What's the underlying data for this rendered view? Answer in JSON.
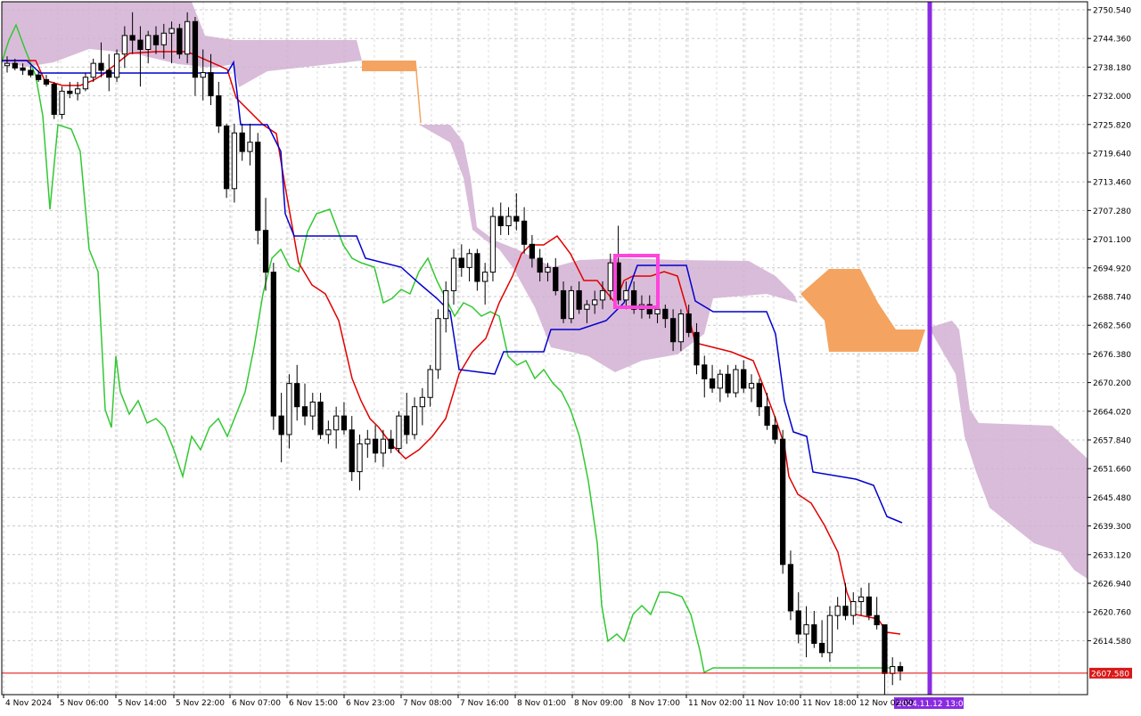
{
  "chart_data": {
    "type": "candlestick",
    "y_ticks": [
      "2750.540",
      "2744.360",
      "2738.180",
      "2732.000",
      "2725.820",
      "2719.640",
      "2713.460",
      "2707.280",
      "2701.100",
      "2694.920",
      "2688.740",
      "2682.560",
      "2676.380",
      "2670.200",
      "2664.020",
      "2657.840",
      "2651.660",
      "2645.480",
      "2639.300",
      "2633.120",
      "2626.940",
      "2620.760",
      "2614.580"
    ],
    "ylim": [
      2603.5,
      2752.5
    ],
    "x_labels": [
      "4 Nov 2024",
      "5 Nov 06:00",
      "5 Nov 14:00",
      "5 Nov 22:00",
      "6 Nov 07:00",
      "6 Nov 15:00",
      "6 Nov 23:00",
      "7 Nov 08:00",
      "7 Nov 16:00",
      "8 Nov 01:00",
      "8 Nov 09:00",
      "8 Nov 17:00",
      "11 Nov 02:00",
      "11 Nov 10:00",
      "11 Nov 18:00",
      "12 Nov 02:00"
    ],
    "current_price": "2607.580",
    "vline_label": "2024.11.12 13:00",
    "candles": [
      [
        2738.5,
        2740.5,
        2737.0,
        2739.0
      ],
      [
        2739.0,
        2740.0,
        2737.5,
        2738.0
      ],
      [
        2738.0,
        2739.0,
        2736.5,
        2737.5
      ],
      [
        2737.5,
        2738.5,
        2736.0,
        2736.5
      ],
      [
        2736.5,
        2737.5,
        2735.0,
        2735.5
      ],
      [
        2735.5,
        2736.5,
        2734.0,
        2734.5
      ],
      [
        2734.5,
        2735.0,
        2727.0,
        2728.0
      ],
      [
        2728.0,
        2734.0,
        2727.0,
        2733.0
      ],
      [
        2733.0,
        2735.0,
        2731.5,
        2732.5
      ],
      [
        2732.5,
        2735.0,
        2731.0,
        2733.5
      ],
      [
        2733.5,
        2737.0,
        2733.0,
        2736.0
      ],
      [
        2736.0,
        2740.0,
        2735.0,
        2739.0
      ],
      [
        2739.0,
        2743.5,
        2736.0,
        2737.5
      ],
      [
        2737.5,
        2741.0,
        2733.0,
        2736.0
      ],
      [
        2736.0,
        2742.0,
        2735.0,
        2741.0
      ],
      [
        2741.0,
        2747.0,
        2738.0,
        2745.0
      ],
      [
        2745.0,
        2750.0,
        2741.0,
        2744.0
      ],
      [
        2744.0,
        2747.0,
        2734.0,
        2742.0
      ],
      [
        2742.0,
        2746.0,
        2739.0,
        2745.0
      ],
      [
        2745.0,
        2747.0,
        2741.0,
        2743.0
      ],
      [
        2743.0,
        2747.5,
        2740.0,
        2745.5
      ],
      [
        2745.5,
        2748.0,
        2739.0,
        2746.5
      ],
      [
        2746.5,
        2747.5,
        2740.0,
        2741.0
      ],
      [
        2741.0,
        2750.0,
        2739.0,
        2748.0
      ],
      [
        2748.0,
        2749.0,
        2732.0,
        2736.0
      ],
      [
        2736.0,
        2742.0,
        2731.0,
        2737.0
      ],
      [
        2737.0,
        2741.0,
        2730.0,
        2732.0
      ],
      [
        2732.0,
        2735.0,
        2724.0,
        2725.5
      ],
      [
        2725.5,
        2726.0,
        2710.0,
        2712.0
      ],
      [
        2712.0,
        2726.0,
        2709.0,
        2724.0
      ],
      [
        2724.0,
        2726.0,
        2718.0,
        2720.0
      ],
      [
        2720.0,
        2726.0,
        2717.0,
        2722.0
      ],
      [
        2722.0,
        2724.0,
        2700.0,
        2703.0
      ],
      [
        2703.0,
        2710.0,
        2690.0,
        2694.0
      ],
      [
        2694.0,
        2696.0,
        2660.0,
        2663.0
      ],
      [
        2663.0,
        2668.0,
        2653.0,
        2659.0
      ],
      [
        2659.0,
        2672.0,
        2656.0,
        2670.0
      ],
      [
        2670.0,
        2674.0,
        2662.0,
        2665.0
      ],
      [
        2665.0,
        2670.0,
        2661.0,
        2663.0
      ],
      [
        2663.0,
        2668.0,
        2660.0,
        2666.0
      ],
      [
        2666.0,
        2668.0,
        2658.0,
        2659.0
      ],
      [
        2659.0,
        2662.0,
        2657.0,
        2660.0
      ],
      [
        2660.0,
        2665.0,
        2656.0,
        2663.0
      ],
      [
        2663.0,
        2666.0,
        2659.0,
        2660.0
      ],
      [
        2660.0,
        2663.0,
        2649.0,
        2651.0
      ],
      [
        2651.0,
        2659.0,
        2647.0,
        2657.0
      ],
      [
        2657.0,
        2660.0,
        2654.0,
        2658.0
      ],
      [
        2658.0,
        2661.0,
        2653.0,
        2655.0
      ],
      [
        2655.0,
        2660.0,
        2652.0,
        2658.0
      ],
      [
        2658.0,
        2660.0,
        2655.0,
        2656.0
      ],
      [
        2656.0,
        2664.0,
        2655.0,
        2663.0
      ],
      [
        2663.0,
        2668.0,
        2657.0,
        2659.0
      ],
      [
        2659.0,
        2667.0,
        2658.0,
        2665.0
      ],
      [
        2665.0,
        2669.0,
        2661.0,
        2667.0
      ],
      [
        2667.0,
        2674.0,
        2665.0,
        2673.0
      ],
      [
        2673.0,
        2686.0,
        2671.0,
        2684.0
      ],
      [
        2684.0,
        2692.0,
        2681.0,
        2690.0
      ],
      [
        2690.0,
        2699.0,
        2687.0,
        2697.0
      ],
      [
        2697.0,
        2700.0,
        2693.0,
        2695.0
      ],
      [
        2695.0,
        2699.0,
        2692.0,
        2698.0
      ],
      [
        2698.0,
        2699.0,
        2690.0,
        2692.0
      ],
      [
        2692.0,
        2696.0,
        2687.0,
        2694.0
      ],
      [
        2694.0,
        2708.0,
        2692.0,
        2706.0
      ],
      [
        2706.0,
        2709.0,
        2702.0,
        2704.0
      ],
      [
        2704.0,
        2708.0,
        2702.0,
        2706.0
      ],
      [
        2706.0,
        2711.0,
        2703.0,
        2705.0
      ],
      [
        2705.0,
        2708.0,
        2698.0,
        2700.0
      ],
      [
        2700.0,
        2702.0,
        2695.0,
        2697.0
      ],
      [
        2697.0,
        2699.0,
        2692.0,
        2694.0
      ],
      [
        2694.0,
        2696.0,
        2692.0,
        2695.0
      ],
      [
        2695.0,
        2697.0,
        2689.0,
        2690.0
      ],
      [
        2690.0,
        2692.0,
        2683.0,
        2684.0
      ],
      [
        2684.0,
        2691.0,
        2683.0,
        2690.0
      ],
      [
        2690.0,
        2692.0,
        2685.0,
        2686.0
      ],
      [
        2686.0,
        2688.0,
        2683.0,
        2687.0
      ],
      [
        2687.0,
        2690.0,
        2685.0,
        2688.0
      ],
      [
        2688.0,
        2692.0,
        2686.0,
        2690.0
      ],
      [
        2690.0,
        2698.0,
        2688.0,
        2696.0
      ],
      [
        2696.0,
        2704.0,
        2687.0,
        2688.0
      ],
      [
        2688.0,
        2692.0,
        2686.0,
        2690.0
      ],
      [
        2690.0,
        2692.0,
        2685.0,
        2686.0
      ],
      [
        2686.0,
        2689.0,
        2684.0,
        2687.0
      ],
      [
        2687.0,
        2689.0,
        2684.0,
        2685.0
      ],
      [
        2685.0,
        2688.0,
        2683.0,
        2686.0
      ],
      [
        2686.0,
        2687.0,
        2682.0,
        2684.0
      ],
      [
        2684.0,
        2686.0,
        2677.0,
        2679.0
      ],
      [
        2679.0,
        2686.0,
        2677.0,
        2685.0
      ],
      [
        2685.0,
        2687.0,
        2680.0,
        2681.0
      ],
      [
        2681.0,
        2683.0,
        2672.0,
        2674.0
      ],
      [
        2674.0,
        2676.0,
        2667.0,
        2671.0
      ],
      [
        2671.0,
        2674.0,
        2668.0,
        2669.0
      ],
      [
        2669.0,
        2673.0,
        2666.0,
        2672.0
      ],
      [
        2672.0,
        2674.0,
        2667.0,
        2668.0
      ],
      [
        2668.0,
        2674.0,
        2667.0,
        2673.0
      ],
      [
        2673.0,
        2675.0,
        2668.0,
        2669.0
      ],
      [
        2669.0,
        2672.0,
        2666.0,
        2670.0
      ],
      [
        2670.0,
        2671.0,
        2663.0,
        2665.0
      ],
      [
        2665.0,
        2668.0,
        2660.0,
        2661.0
      ],
      [
        2661.0,
        2663.0,
        2657.0,
        2658.0
      ],
      [
        2658.0,
        2660.0,
        2629.0,
        2631.0
      ],
      [
        2631.0,
        2634.0,
        2619.0,
        2621.0
      ],
      [
        2621.0,
        2625.0,
        2614.0,
        2616.0
      ],
      [
        2616.0,
        2622.0,
        2611.0,
        2618.0
      ],
      [
        2618.0,
        2621.0,
        2613.0,
        2614.0
      ],
      [
        2614.0,
        2619.0,
        2611.0,
        2612.0
      ],
      [
        2612.0,
        2622.0,
        2610.0,
        2620.0
      ],
      [
        2620.0,
        2624.0,
        2617.0,
        2622.0
      ],
      [
        2622.0,
        2627.0,
        2619.0,
        2620.0
      ],
      [
        2620.0,
        2625.0,
        2618.0,
        2623.0
      ],
      [
        2623.0,
        2626.0,
        2620.0,
        2624.0
      ],
      [
        2624.0,
        2627.0,
        2619.0,
        2620.0
      ],
      [
        2620.0,
        2624.0,
        2617.0,
        2618.0
      ],
      [
        2618.0,
        2616.0,
        2603.0,
        2607.5
      ],
      [
        2607.5,
        2611.0,
        2605.0,
        2609.0
      ],
      [
        2609.0,
        2610.0,
        2606.0,
        2608.0
      ]
    ]
  }
}
